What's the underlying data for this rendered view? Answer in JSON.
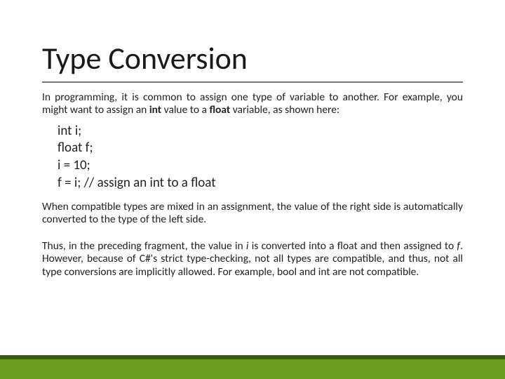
{
  "title": "Type Conversion",
  "p1": {
    "pre": "In programming, it is common to assign one type of variable to another. For example, you might want to assign an ",
    "int": "int",
    "mid": " value to a ",
    "float": "float",
    "post": " variable, as shown here:"
  },
  "code": {
    "l1": "int i;",
    "l2": "float f;",
    "l3": "i = 10;",
    "l4": "f = i; // assign an int to a float"
  },
  "p2": "When compatible types are mixed in an assignment, the value of the right side is automatically converted to the type of the left side.",
  "p3": {
    "a": "Thus, in the preceding fragment, the value in ",
    "i": "i",
    "b": " is converted into a float and then assigned to ",
    "f": "f",
    "c": ". However, because of C#'s strict type-checking, not all types are compatible, and thus, not all type conversions are implicitly allowed. For example, bool and int are not compatible."
  }
}
